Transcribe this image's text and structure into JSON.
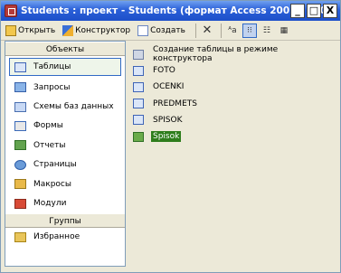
{
  "window": {
    "title": "Students : проект - Students (формат Access 2002 - 2003)",
    "controls": {
      "minimize": "_",
      "maximize": "□",
      "close": "X"
    }
  },
  "toolbar": {
    "open_label": "Открыть",
    "design_label": "Конструктор",
    "create_label": "Создать",
    "delete_label": "✕",
    "view_large": "ᴬa",
    "view_small": "⁝⁝",
    "view_list": "☷",
    "view_details": "▦"
  },
  "sidebar": {
    "objects_header": "Объекты",
    "items": [
      {
        "label": "Таблицы",
        "icon": "table-icon"
      },
      {
        "label": "Запросы",
        "icon": "query-icon"
      },
      {
        "label": "Схемы баз данных",
        "icon": "schema-icon"
      },
      {
        "label": "Формы",
        "icon": "form-icon"
      },
      {
        "label": "Отчеты",
        "icon": "report-icon"
      },
      {
        "label": "Страницы",
        "icon": "page-icon"
      },
      {
        "label": "Макросы",
        "icon": "macro-icon"
      },
      {
        "label": "Модули",
        "icon": "module-icon"
      }
    ],
    "groups_header": "Группы",
    "group_items": [
      {
        "label": "Избранное",
        "icon": "favorites-icon"
      }
    ]
  },
  "main": {
    "items": [
      {
        "label": "Создание таблицы в режиме конструктора"
      },
      {
        "label": "FOTO"
      },
      {
        "label": "OCENKI"
      },
      {
        "label": "PREDMETS"
      },
      {
        "label": "SPISOK"
      },
      {
        "label": "Spisok"
      }
    ]
  }
}
